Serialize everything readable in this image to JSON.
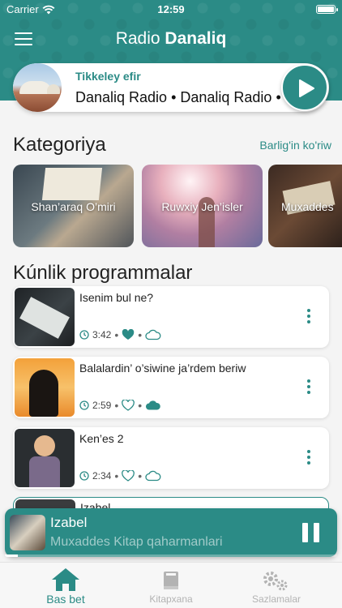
{
  "status_bar": {
    "carrier": "Carrier",
    "time": "12:59"
  },
  "header": {
    "title_regular": "Radio",
    "title_bold": "Danaliq"
  },
  "live": {
    "label": "Tikkeley efir",
    "ticker": "Danaliq Radio • Danaliq Radio •"
  },
  "categories": {
    "title": "Kategoriya",
    "see_all": "Barlig'in ko'riw",
    "items": [
      {
        "label": "Shan’araq O’miri"
      },
      {
        "label": "Ruwxiy Jen’isler"
      },
      {
        "label": "Muxaddes"
      }
    ]
  },
  "programs": {
    "title": "Kúnlik programmalar",
    "items": [
      {
        "title": "Isenim bul ne?",
        "duration": "3:42",
        "liked": true,
        "downloaded": false
      },
      {
        "title": "Balalardin’ o’siwine ja’rdem beriw",
        "duration": "2:59",
        "liked": false,
        "downloaded": true
      },
      {
        "title": "Ken’es 2",
        "duration": "2:34",
        "liked": false,
        "downloaded": false
      },
      {
        "title": "Izabel"
      }
    ]
  },
  "player": {
    "title": "Izabel",
    "subtitle": "Muxaddes Kitap qaharmanlari",
    "progress": 0.04
  },
  "tabs": [
    {
      "label": "Bas bet",
      "icon": "home-icon",
      "active": true
    },
    {
      "label": "Kitapxana",
      "icon": "library-icon",
      "active": false
    },
    {
      "label": "Sazlamalar",
      "icon": "settings-icon",
      "active": false
    }
  ],
  "colors": {
    "accent": "#2b8b86",
    "tab_inactive": "#b3b3b3"
  }
}
